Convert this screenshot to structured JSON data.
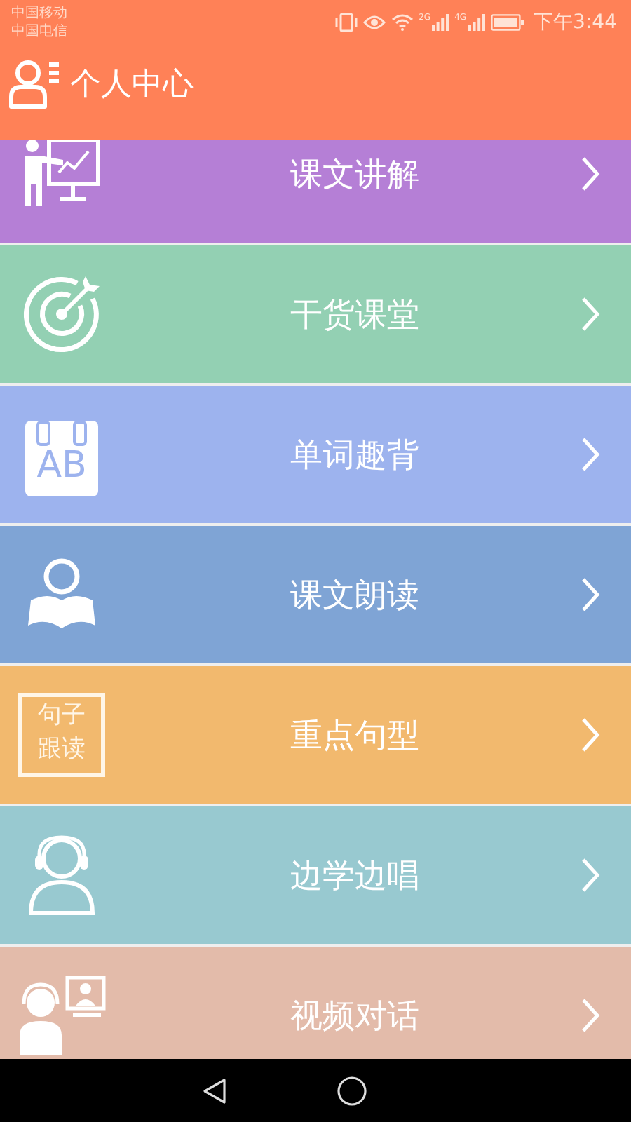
{
  "status_bar": {
    "carriers": [
      "中国移动",
      "中国电信"
    ],
    "networks": [
      "2G",
      "4G"
    ],
    "time": "下午3:44"
  },
  "header": {
    "title": "个人中心"
  },
  "menu": [
    {
      "label": "课文讲解",
      "color": "#b57fd6",
      "kind": "presenter"
    },
    {
      "label": "干货课堂",
      "color": "#93d0b3",
      "kind": "target"
    },
    {
      "label": "单词趣背",
      "color": "#9db3ee",
      "kind": "calendar",
      "icon_text": "AB"
    },
    {
      "label": "课文朗读",
      "color": "#7fa4d5",
      "kind": "reader"
    },
    {
      "label": "重点句型",
      "color": "#f2b96e",
      "kind": "card",
      "icon_text": "句子跟读"
    },
    {
      "label": "边学边唱",
      "color": "#98c9d0",
      "kind": "headset"
    },
    {
      "label": "视频对话",
      "color": "#e3bbaa",
      "kind": "video"
    }
  ]
}
